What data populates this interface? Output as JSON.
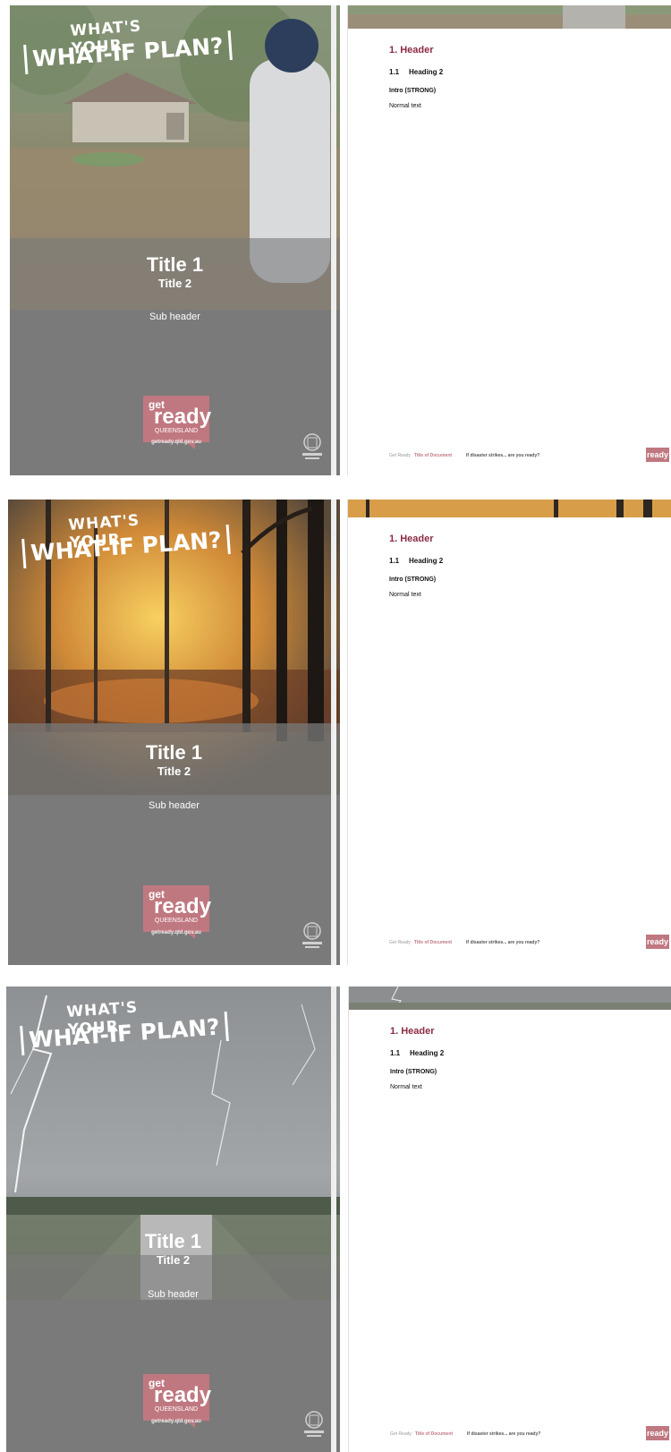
{
  "pages": [
    {
      "theme": "flood",
      "cover": {
        "whatif_top": "WHAT'S YOUR",
        "whatif_main": "WHAT-IF PLAN?",
        "title1": "Title 1",
        "title2": "Title 2",
        "sub_header": "Sub header",
        "logo_get": "get",
        "logo_ready": "ready",
        "logo_region": "QUEENSLAND",
        "url": "getready.qld.gov.au",
        "crest_label": "Queensland Government"
      },
      "doc": {
        "header": "1. Header",
        "heading2_num": "1.1",
        "heading2": "Heading 2",
        "intro": "Intro (STRONG)",
        "normal": "Normal text",
        "footer_brand": "Get Ready",
        "footer_title": "Title of Document",
        "footer_question": "If disaster strikes... are you ready?"
      }
    },
    {
      "theme": "bushfire",
      "cover": {
        "whatif_top": "WHAT'S YOUR",
        "whatif_main": "WHAT-IF PLAN?",
        "title1": "Title 1",
        "title2": "Title 2",
        "sub_header": "Sub header",
        "logo_get": "get",
        "logo_ready": "ready",
        "logo_region": "QUEENSLAND",
        "url": "getready.qld.gov.au",
        "crest_label": "Queensland Government"
      },
      "doc": {
        "header": "1. Header",
        "heading2_num": "1.1",
        "heading2": "Heading 2",
        "intro": "Intro (STRONG)",
        "normal": "Normal text",
        "footer_brand": "Get Ready",
        "footer_title": "Title of Document",
        "footer_question": "If disaster strikes... are you ready?"
      }
    },
    {
      "theme": "storm",
      "cover": {
        "whatif_top": "WHAT'S YOUR",
        "whatif_main": "WHAT-IF PLAN?",
        "title1": "Title 1",
        "title2": "Title 2",
        "sub_header": "Sub header",
        "logo_get": "get",
        "logo_ready": "ready",
        "logo_region": "QUEENSLAND",
        "url": "getready.qld.gov.au",
        "crest_label": "Queensland Government"
      },
      "doc": {
        "header": "1. Header",
        "heading2_num": "1.1",
        "heading2": "Heading 2",
        "intro": "Intro (STRONG)",
        "normal": "Normal text",
        "footer_brand": "Get Ready",
        "footer_title": "Title of Document",
        "footer_question": "If disaster strikes... are you ready?"
      }
    }
  ],
  "colors": {
    "accent": "#8b2b45",
    "logo_pink": "#c07880",
    "cover_grey": "#7a7a7a"
  }
}
